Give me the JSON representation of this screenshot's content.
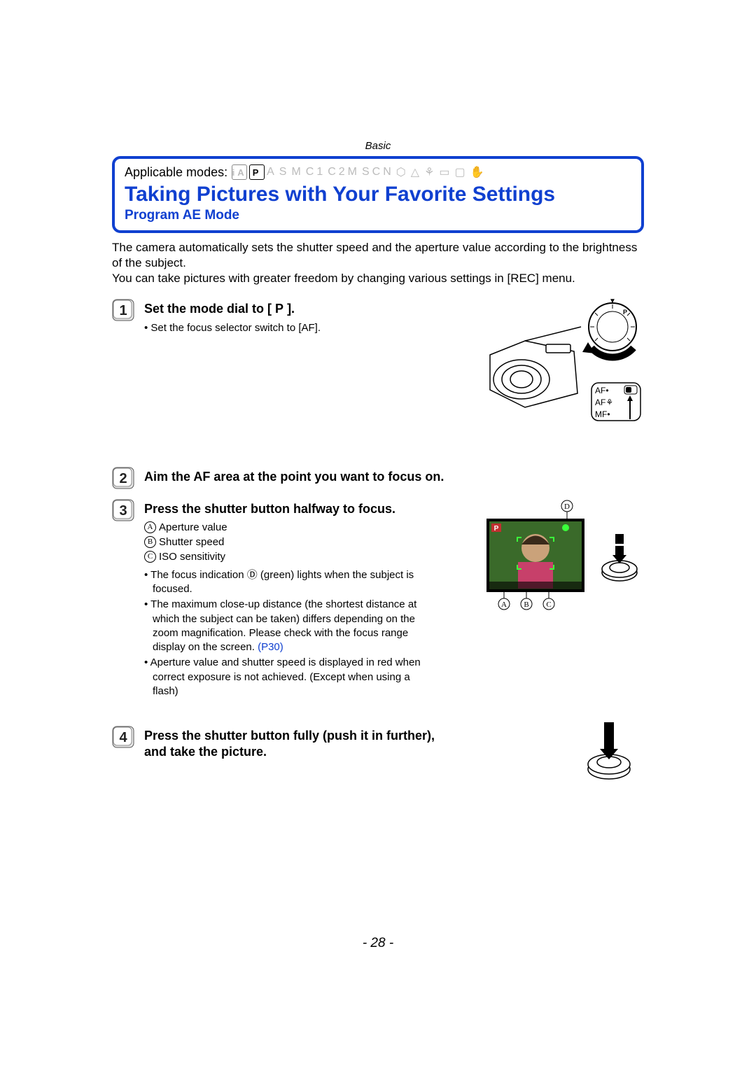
{
  "section_header": "Basic",
  "applicable_label": "Applicable modes:",
  "mode_icons": [
    "iA",
    "P",
    "A",
    "S",
    "M",
    "C1",
    "C2M",
    "SCN",
    "⬡",
    "△",
    "⚘",
    "▭",
    "▢",
    "✋"
  ],
  "title": "Taking Pictures with Your Favorite Settings",
  "subtitle": "Program AE Mode",
  "intro_1": "The camera automatically sets the shutter speed and the aperture value according to the brightness of the subject.",
  "intro_2": "You can take pictures with greater freedom by changing various settings in [REC] menu.",
  "steps": {
    "1": {
      "text_a": "Set the mode dial to [",
      "text_b": "].",
      "p_glyph": "P",
      "bullet": "Set the focus selector switch to [AF]."
    },
    "2": {
      "text": "Aim the AF area at the point you want to focus on."
    },
    "3": {
      "text": "Press the shutter button halfway to focus.",
      "legend": {
        "A": "Aperture value",
        "B": "Shutter speed",
        "C": "ISO sensitivity"
      },
      "bullets": [
        "The focus indication Ⓓ (green) lights when the subject is focused.",
        "The maximum close-up distance (the shortest distance at which the subject can be taken) differs depending on the zoom magnification. Please check with the focus range display on the screen.",
        "Aperture value and shutter speed is displayed in red when correct exposure is not achieved. (Except when using a flash)"
      ],
      "link": "(P30)"
    },
    "4": {
      "text": "Press the shutter button fully (push it in further), and take the picture."
    }
  },
  "fig1": {
    "af_macro": "AF⚘",
    "af": "AF•",
    "mf": "MF•"
  },
  "fig2": {
    "badge_p": "P",
    "status_icon": "⬤",
    "labels": [
      "A",
      "B",
      "C",
      "D"
    ]
  },
  "page_number": "- 28 -"
}
